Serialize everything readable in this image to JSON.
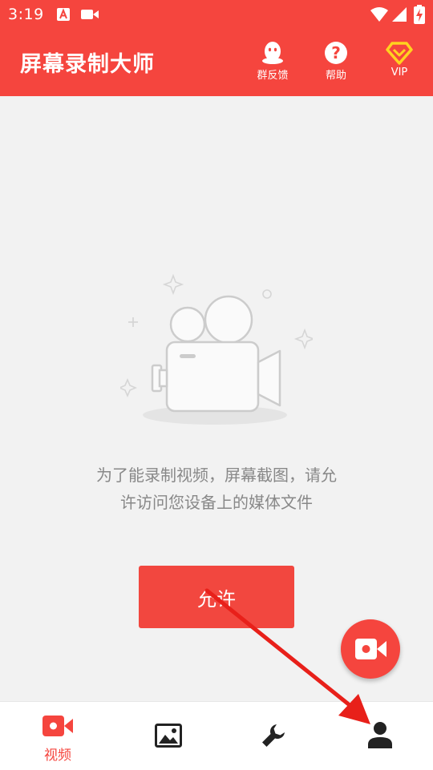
{
  "status_bar": {
    "time": "3:19",
    "icons": [
      "a11y-notification-icon",
      "screen-record-icon",
      "wifi-icon",
      "signal-icon",
      "battery-charging-icon"
    ]
  },
  "app_bar": {
    "title": "屏幕录制大师",
    "actions": [
      {
        "icon": "qq-penguin-icon",
        "label": "群反馈"
      },
      {
        "icon": "help-icon",
        "label": "帮助"
      },
      {
        "icon": "vip-diamond-icon",
        "label": "VIP"
      }
    ]
  },
  "empty_state": {
    "illustration": "video-camera-icon",
    "message_line1": "为了能录制视频，屏幕截图，请允",
    "message_line2": "许访问您设备上的媒体文件",
    "allow_button": "允许"
  },
  "fab": {
    "icon": "record-video-icon"
  },
  "bottom_nav": {
    "items": [
      {
        "icon": "video-icon",
        "label": "视频",
        "active": true
      },
      {
        "icon": "image-icon",
        "label": "",
        "active": false
      },
      {
        "icon": "wrench-icon",
        "label": "",
        "active": false
      },
      {
        "icon": "person-icon",
        "label": "",
        "active": false
      }
    ]
  },
  "colors": {
    "accent": "#f5453e",
    "background": "#f2f2f2",
    "message_text": "#888888",
    "nav_icon": "#222222",
    "arrow": "#e8201a"
  }
}
